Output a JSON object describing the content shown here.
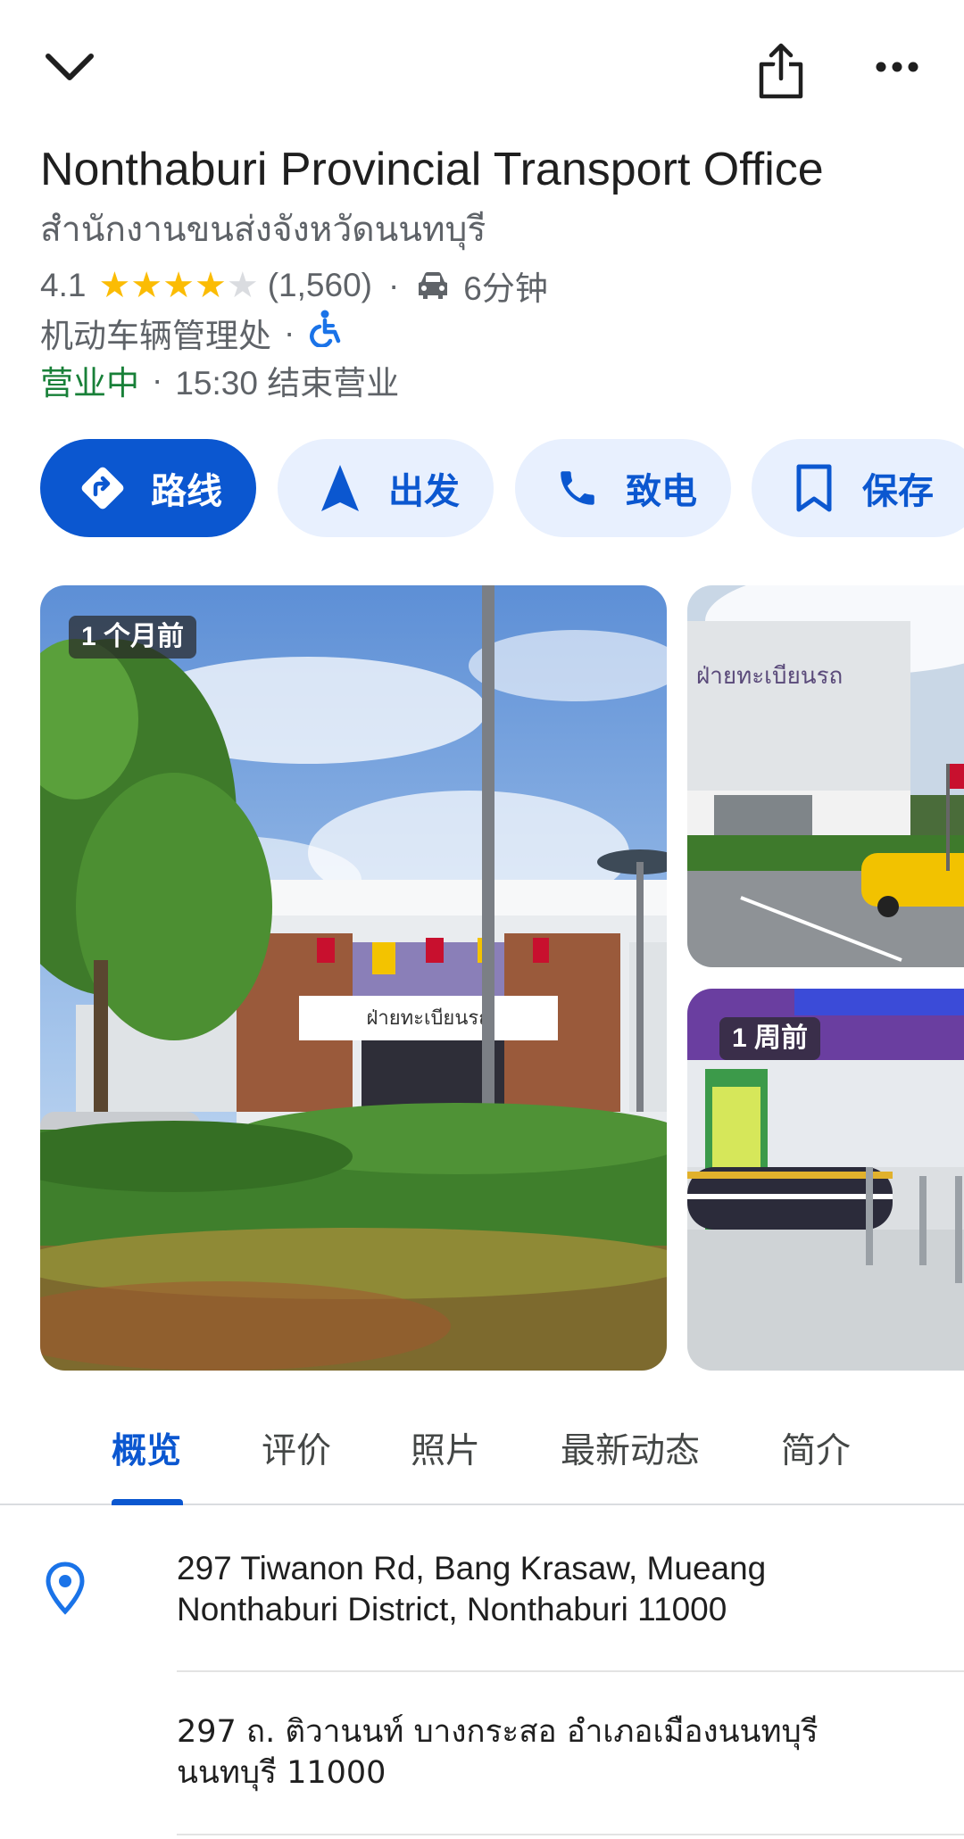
{
  "header": {
    "collapse_icon": "chevron-down-icon",
    "share_icon": "share-icon",
    "more_icon": "more-horizontal-icon"
  },
  "place": {
    "name": "Nonthaburi Provincial Transport Office",
    "local_name": "สำนักงานขนส่งจังหวัดนนทบุรี",
    "rating": "4.1",
    "rating_value": 4.1,
    "review_count": "(1,560)",
    "drive_time": "6分钟",
    "category": "机动车辆管理处",
    "status_open": "营业中",
    "status_close": "15:30 结束营业"
  },
  "actions": {
    "directions": "路线",
    "start": "出发",
    "call": "致电",
    "save": "保存"
  },
  "photos": {
    "main_badge": "1 个月前",
    "side_bottom_badge": "1 周前",
    "building_sign": "ฝ่ายทะเบียนรถ"
  },
  "tabs": [
    "概览",
    "评价",
    "照片",
    "最新动态",
    "简介"
  ],
  "address": {
    "line1": "297 Tiwanon Rd, Bang Krasaw, Mueang",
    "line2": "Nonthaburi District, Nonthaburi 11000",
    "thai_line1": "297 ถ. ติวานนท์ บางกระสอ อำเภอเมืองนนทบุรี",
    "thai_line2": "นนทบุรี 11000"
  },
  "colors": {
    "accent": "#0b57d0",
    "open": "#188038",
    "star": "#fbbc04",
    "accessible": "#1a73e8"
  }
}
